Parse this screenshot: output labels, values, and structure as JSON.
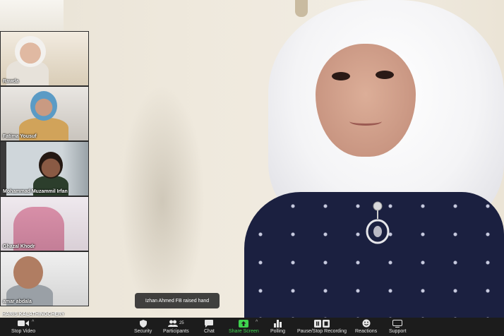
{
  "participants": [
    {
      "name": "Rawda"
    },
    {
      "name": "Fatima Yousuf"
    },
    {
      "name": "Mohammad Muzammil Irfan"
    },
    {
      "name": "Ghazal Khodr"
    },
    {
      "name": "amar abdala"
    }
  ],
  "cutoff_participant": "HARIS KALATHINGCHERY",
  "toast": {
    "message": "Izhan  Ahmed FB raised hand"
  },
  "toolbar": {
    "stop_video": "Stop Video",
    "security": "Security",
    "participants": "Participants",
    "participants_count": "25",
    "chat": "Chat",
    "share_screen": "Share Screen",
    "polling": "Polling",
    "pause_recording": "Pause/Stop Recording",
    "reactions": "Reactions",
    "support": "Support"
  },
  "icons": {
    "video": "video-camera-icon",
    "security": "shield-icon",
    "participants": "people-icon",
    "chat": "chat-bubble-icon",
    "share": "share-arrow-icon",
    "polling": "bar-chart-icon",
    "recording": "pause-stop-icon",
    "reactions": "smiley-icon",
    "support": "support-icon"
  },
  "colors": {
    "share_accent": "#3fd34f",
    "toolbar_bg": "#1c1c1c"
  }
}
